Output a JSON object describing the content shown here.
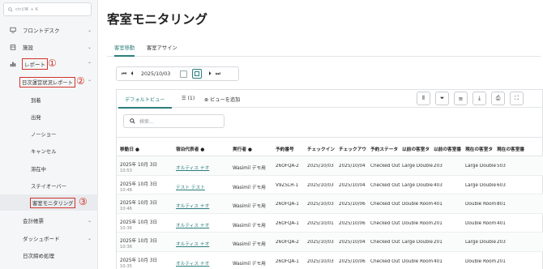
{
  "sidebar": {
    "search_placeholder": "ctrl/⌘ + K",
    "items": [
      {
        "label": "フロントデスク",
        "icon": "monitor-icon",
        "chevron": "⌄"
      },
      {
        "label": "施設",
        "icon": "building-icon",
        "chevron": "⌄"
      },
      {
        "label": "レポート",
        "icon": "bar-chart-icon",
        "chevron": "⌃"
      }
    ],
    "report_group": {
      "label": "日次運営状況レポート",
      "chevron": "⌃"
    },
    "report_children": [
      "到着",
      "出発",
      "ノーショー",
      "キャンセル",
      "滞在中",
      "ステイオーバー",
      "客室モニタリング"
    ],
    "bottom_items": [
      {
        "label": "会計帳票",
        "chevron": "⌄"
      },
      {
        "label": "ダッシュボード",
        "chevron": "⌄"
      },
      {
        "label": "日次締め処理",
        "chevron": ""
      }
    ],
    "annotations": [
      "①",
      "②",
      "③"
    ]
  },
  "main": {
    "title": "客室モニタリング",
    "tabs": [
      "客室移動",
      "客室アサイン"
    ],
    "date": "2025/10/03",
    "view_tabs": {
      "default": "デフォルトビュー",
      "views_count": "(1)",
      "add_view": "ビューを追加"
    },
    "table_search_placeholder": "検索..."
  },
  "table": {
    "columns": [
      "移動日",
      "宿泊代表者",
      "実行者",
      "予約番号",
      "チェックイン",
      "チェックアウ",
      "予約ステータ",
      "以前の客室タ",
      "以前の客室番",
      "現在の客室タ",
      "現在の客室番"
    ],
    "rows": [
      {
        "date": "2025年 10月 3日",
        "time": "10:53",
        "guest": "オルティス ナオ",
        "actor": "Wasimil デモ用",
        "rsv": "26OFQA-2",
        "ci": "2025/10/03",
        "co": "2025/10/04",
        "status": "Checked Out",
        "prev_type": "Large Double",
        "prev_no": "203",
        "cur_type": "Large Double",
        "cur_no": "503"
      },
      {
        "date": "2025年 10月 3日",
        "time": "10:48",
        "guest": "テスト テスト",
        "actor": "Wasimil デモ用",
        "rsv": "V9Z5LH-1",
        "ci": "2025/10/03",
        "co": "2025/10/04",
        "status": "Checked Out",
        "prev_type": "Large Double",
        "prev_no": "403",
        "cur_type": "Large Double",
        "cur_no": "603"
      },
      {
        "date": "2025年 10月 3日",
        "time": "10:46",
        "guest": "オルティス ナオ",
        "actor": "Wasimil デモ用",
        "rsv": "26OFQA-1",
        "ci": "2025/10/03",
        "co": "2025/10/06",
        "status": "Checked Out",
        "prev_type": "Double Room",
        "prev_no": "401",
        "cur_type": "Double Room",
        "cur_no": "801"
      },
      {
        "date": "2025年 10月 3日",
        "time": "10:36",
        "guest": "オルティス ナオ",
        "actor": "Wasimil デモ用",
        "rsv": "26OFQA-1",
        "ci": "2025/10/01",
        "co": "2025/10/06",
        "status": "Checked Out",
        "prev_type": "Double Room",
        "prev_no": "201",
        "cur_type": "Double Room",
        "cur_no": "401"
      },
      {
        "date": "2025年 10月 3日",
        "time": "10:36",
        "guest": "オルティス ナオ",
        "actor": "Wasimil デモ用",
        "rsv": "26OFQA-2",
        "ci": "2025/10/03",
        "co": "2025/10/04",
        "status": "Checked Out",
        "prev_type": "Large Double",
        "prev_no": "201",
        "cur_type": "Large Double",
        "cur_no": "203"
      },
      {
        "date": "2025年 10月 3日",
        "time": "10:35",
        "guest": "オルティス ナオ",
        "actor": "Wasimil デモ用",
        "rsv": "26OFQA-1",
        "ci": "2025/10/03",
        "co": "2025/10/06",
        "status": "Checked Out",
        "prev_type": "Double Room",
        "prev_no": "401",
        "cur_type": "Double Room",
        "cur_no": "201"
      }
    ]
  },
  "colors": {
    "accent": "#2d7d7d",
    "annotation_red": "#d0342c"
  }
}
